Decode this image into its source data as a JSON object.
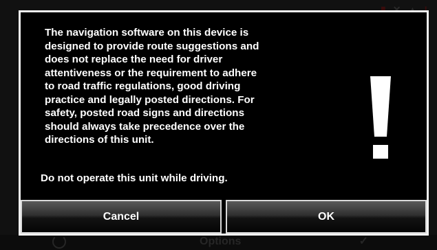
{
  "dialog": {
    "message": "The navigation software on this device is\ndesigned to provide route suggestions and\ndoes not replace the need for driver\nattentiveness or the requirement to adhere\nto road traffic regulations, good driving\npractice and legally posted directions.  For\nsafety, posted road signs and directions\nshould always take precedence over the\ndirections of this unit.",
    "warning": "Do not operate this unit while driving.",
    "icon": "exclamation-icon",
    "buttons": {
      "cancel": "Cancel",
      "ok": "OK"
    }
  },
  "background": {
    "bottom_bar_label": "Options",
    "status_icons": [
      "battery-icon",
      "mute-icon",
      "signal-icon",
      "alert-icon"
    ]
  },
  "colors": {
    "dialog_background": "#000000",
    "dialog_border": "#f2f2f2",
    "text": "#ffffff"
  }
}
